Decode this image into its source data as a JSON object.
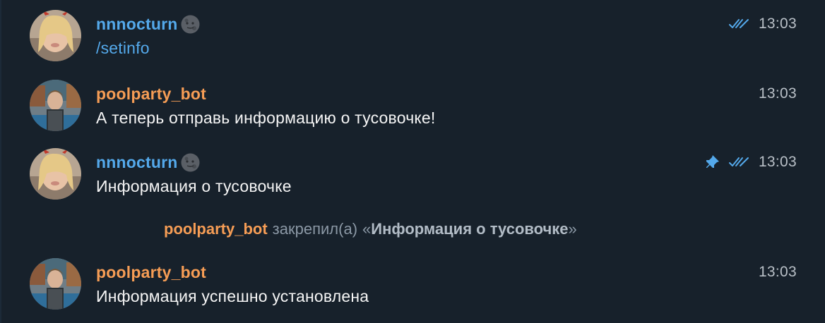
{
  "messages": [
    {
      "sender": "nnnocturn",
      "sender_emoji": "new-moon-face-emoji",
      "text": "/setinfo",
      "time": "13:03",
      "read": true,
      "pinned": false
    },
    {
      "sender": "poolparty_bot",
      "text": "А теперь отправь информацию о тусовочке!",
      "time": "13:03"
    },
    {
      "sender": "nnnocturn",
      "sender_emoji": "new-moon-face-emoji",
      "text": "Информация о тусовочке",
      "time": "13:03",
      "read": true,
      "pinned": true
    },
    {
      "sender": "poolparty_bot",
      "text": "Информация успешно установлена",
      "time": "13:03"
    }
  ],
  "service": {
    "actor": "poolparty_bot",
    "action": "закрепил(а)",
    "quote_open": "«",
    "quote_text": "Информация о тусовочке",
    "quote_close": "»"
  },
  "colors": {
    "background": "#17212b",
    "user_name": "#54a9eb",
    "bot_name": "#f69d55",
    "message_text": "#f5f5f5",
    "time": "#b9c0c7",
    "check_marks": "#54a9eb"
  }
}
